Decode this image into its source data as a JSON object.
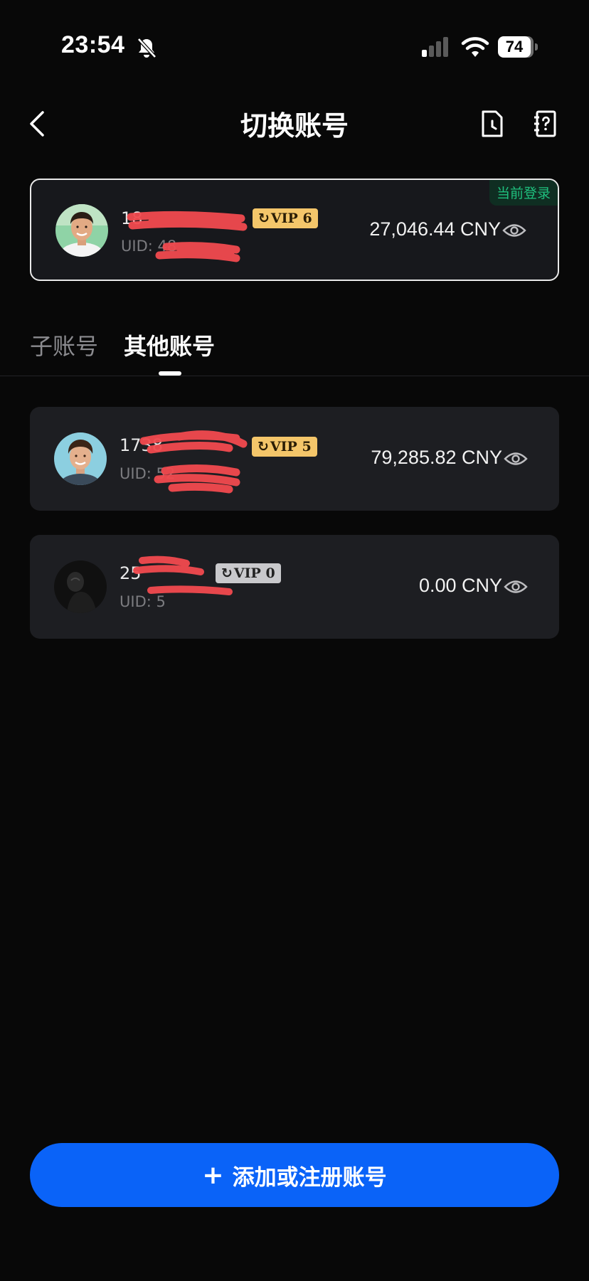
{
  "status_bar": {
    "time": "23:54",
    "battery": "74"
  },
  "header": {
    "title": "切换账号"
  },
  "current_account": {
    "name": "18",
    "uid": "UID: 48",
    "vip": "VIP 6",
    "balance": "27,046.44 CNY",
    "tag": "当前登录"
  },
  "tabs": [
    {
      "label": "子账号",
      "active": false
    },
    {
      "label": "其他账号",
      "active": true
    }
  ],
  "other_accounts": [
    {
      "name": "1738",
      "uid": "UID: 52",
      "vip": "VIP 5",
      "balance": "79,285.82 CNY"
    },
    {
      "name": "25",
      "uid": "UID: 5",
      "vip": "VIP 0",
      "balance": "0.00 CNY"
    }
  ],
  "add_button": {
    "plus": "+",
    "label": "添加或注册账号"
  },
  "colors": {
    "accent": "#0a63f8",
    "vip_gold": "#f4c66a",
    "current_tag": "#1fc07e",
    "redaction": "#f24a4f"
  }
}
